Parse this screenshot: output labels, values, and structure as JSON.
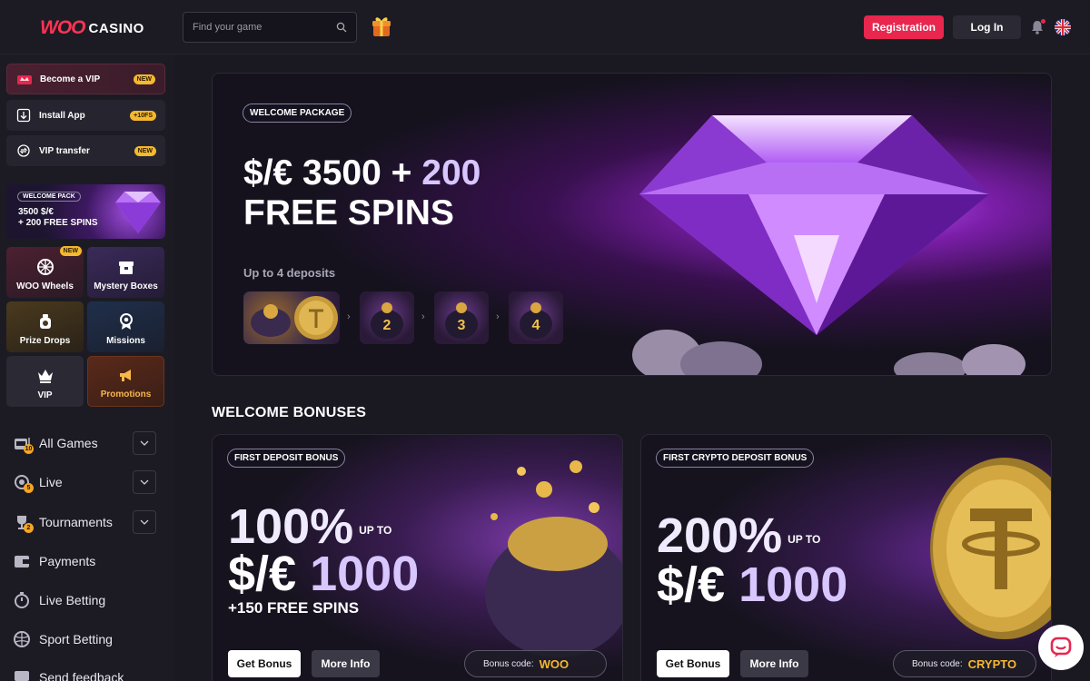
{
  "header": {
    "logo_woo": "WOO",
    "logo_casino": "CASINO",
    "search_placeholder": "Find your game",
    "registration_label": "Registration",
    "login_label": "Log In"
  },
  "sidebar": {
    "promo_items": [
      {
        "label": "Become a VIP",
        "badge": "NEW",
        "icon": "crown-card-icon"
      },
      {
        "label": "Install App",
        "badge": "+10FS",
        "icon": "download-icon"
      },
      {
        "label": "VIP transfer",
        "badge": "NEW",
        "icon": "transfer-icon"
      }
    ],
    "welcome_card": {
      "tag": "WELCOME PACK",
      "line1": "3500 $/€",
      "line2": "+ 200 FREE SPINS"
    },
    "tiles": [
      {
        "label": "WOO Wheels",
        "badge": "NEW",
        "icon": "wheel-icon"
      },
      {
        "label": "Mystery Boxes",
        "icon": "box-icon"
      },
      {
        "label": "Prize Drops",
        "icon": "prize-drop-icon"
      },
      {
        "label": "Missions",
        "icon": "medal-icon"
      },
      {
        "label": "VIP",
        "icon": "crown-icon"
      },
      {
        "label": "Promotions",
        "icon": "megaphone-icon"
      }
    ],
    "nav": [
      {
        "label": "All Games",
        "count": "10",
        "expandable": true,
        "icon": "slot-icon"
      },
      {
        "label": "Live",
        "count": "5",
        "expandable": true,
        "icon": "live-icon"
      },
      {
        "label": "Tournaments",
        "count": "2",
        "expandable": true,
        "icon": "trophy-icon"
      },
      {
        "label": "Payments",
        "expandable": false,
        "icon": "wallet-icon"
      },
      {
        "label": "Live Betting",
        "expandable": false,
        "icon": "stopwatch-icon"
      },
      {
        "label": "Sport Betting",
        "expandable": false,
        "icon": "ball-icon"
      },
      {
        "label": "Send feedback",
        "expandable": false,
        "icon": "feedback-icon"
      }
    ]
  },
  "hero": {
    "tag": "WELCOME PACKAGE",
    "amount": "$/€ 3500 +",
    "spins_count": "200",
    "spins_label": "FREE SPINS",
    "subtitle": "Up to 4 deposits",
    "deposit_steps": [
      "2",
      "3",
      "4"
    ]
  },
  "bonuses": {
    "section_title": "WELCOME BONUSES",
    "cards": [
      {
        "tag": "FIRST DEPOSIT BONUS",
        "percent": "100%",
        "upto": "UP TO",
        "currency": "$/€",
        "amount": "1000",
        "extra": "+150 FREE SPINS",
        "get_label": "Get Bonus",
        "more_label": "More Info",
        "code_label": "Bonus code:",
        "code": "WOO"
      },
      {
        "tag": "FIRST CRYPTO DEPOSIT BONUS",
        "percent": "200%",
        "upto": "UP TO",
        "currency": "$/€",
        "amount": "1000",
        "get_label": "Get Bonus",
        "more_label": "More Info",
        "code_label": "Bonus code:",
        "code": "CRYPTO"
      }
    ]
  },
  "colors": {
    "accent": "#e8264e",
    "background": "#1a1922",
    "sidebar": "#1c1b24",
    "highlight_purple": "#d8c6ff",
    "code_gold": "#f5b82e"
  }
}
